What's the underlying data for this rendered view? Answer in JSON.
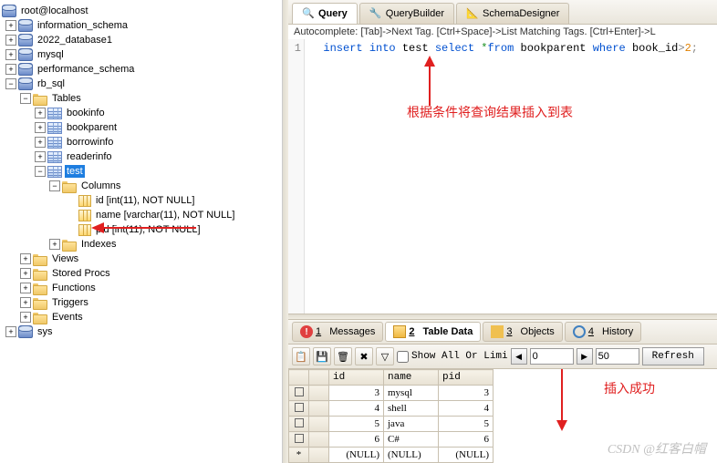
{
  "connection": "root@localhost",
  "databases": [
    "information_schema",
    "2022_database1",
    "mysql",
    "performance_schema",
    "rb_sql",
    "sys"
  ],
  "rb_sql": {
    "folders": [
      "Tables",
      "Views",
      "Stored Procs",
      "Functions",
      "Triggers",
      "Events"
    ],
    "tables": [
      "bookinfo",
      "bookparent",
      "borrowinfo",
      "readerinfo",
      "test"
    ],
    "selected_table": "test",
    "columns_label": "Columns",
    "indexes_label": "Indexes",
    "test_columns": [
      "id [int(11), NOT NULL]",
      "name [varchar(11), NOT NULL]",
      "pid [int(11), NOT NULL]"
    ]
  },
  "top_tabs": {
    "query": "Query",
    "builder": "QueryBuilder",
    "schema": "SchemaDesigner"
  },
  "autocomplete_hint": "Autocomplete: [Tab]->Next Tag. [Ctrl+Space]->List Matching Tags. [Ctrl+Enter]->L",
  "sql": {
    "line": "1",
    "kw_insert": "insert",
    "kw_into": "into",
    "tbl_test": "test",
    "kw_select": "select",
    "star": "*",
    "kw_from": "from",
    "tbl_bookparent": "bookparent",
    "kw_where": "where",
    "col_book_id": "book_id",
    "gt": ">",
    "val": "2",
    "semi": ";"
  },
  "annotations": {
    "a1": "根据条件将查询结果插入到表",
    "a2": "插入成功"
  },
  "bottom_tabs": {
    "messages": {
      "num": "1",
      "label": "Messages"
    },
    "tabledata": {
      "num": "2",
      "label": "Table Data"
    },
    "objects": {
      "num": "3",
      "label": "Objects"
    },
    "history": {
      "num": "4",
      "label": "History"
    }
  },
  "toolbar2": {
    "show_all": "Show All Or Limi",
    "offset": "0",
    "limit": "50",
    "refresh": "Refresh"
  },
  "grid": {
    "headers": [
      "id",
      "name",
      "pid"
    ],
    "rows": [
      {
        "id": "3",
        "name": "mysql",
        "pid": "3"
      },
      {
        "id": "4",
        "name": "shell",
        "pid": "4"
      },
      {
        "id": "5",
        "name": "java",
        "pid": "5"
      },
      {
        "id": "6",
        "name": "C#",
        "pid": "6"
      }
    ],
    "null_row": {
      "star": "*",
      "null": "(NULL)"
    }
  },
  "watermark": "CSDN @红客白帽"
}
